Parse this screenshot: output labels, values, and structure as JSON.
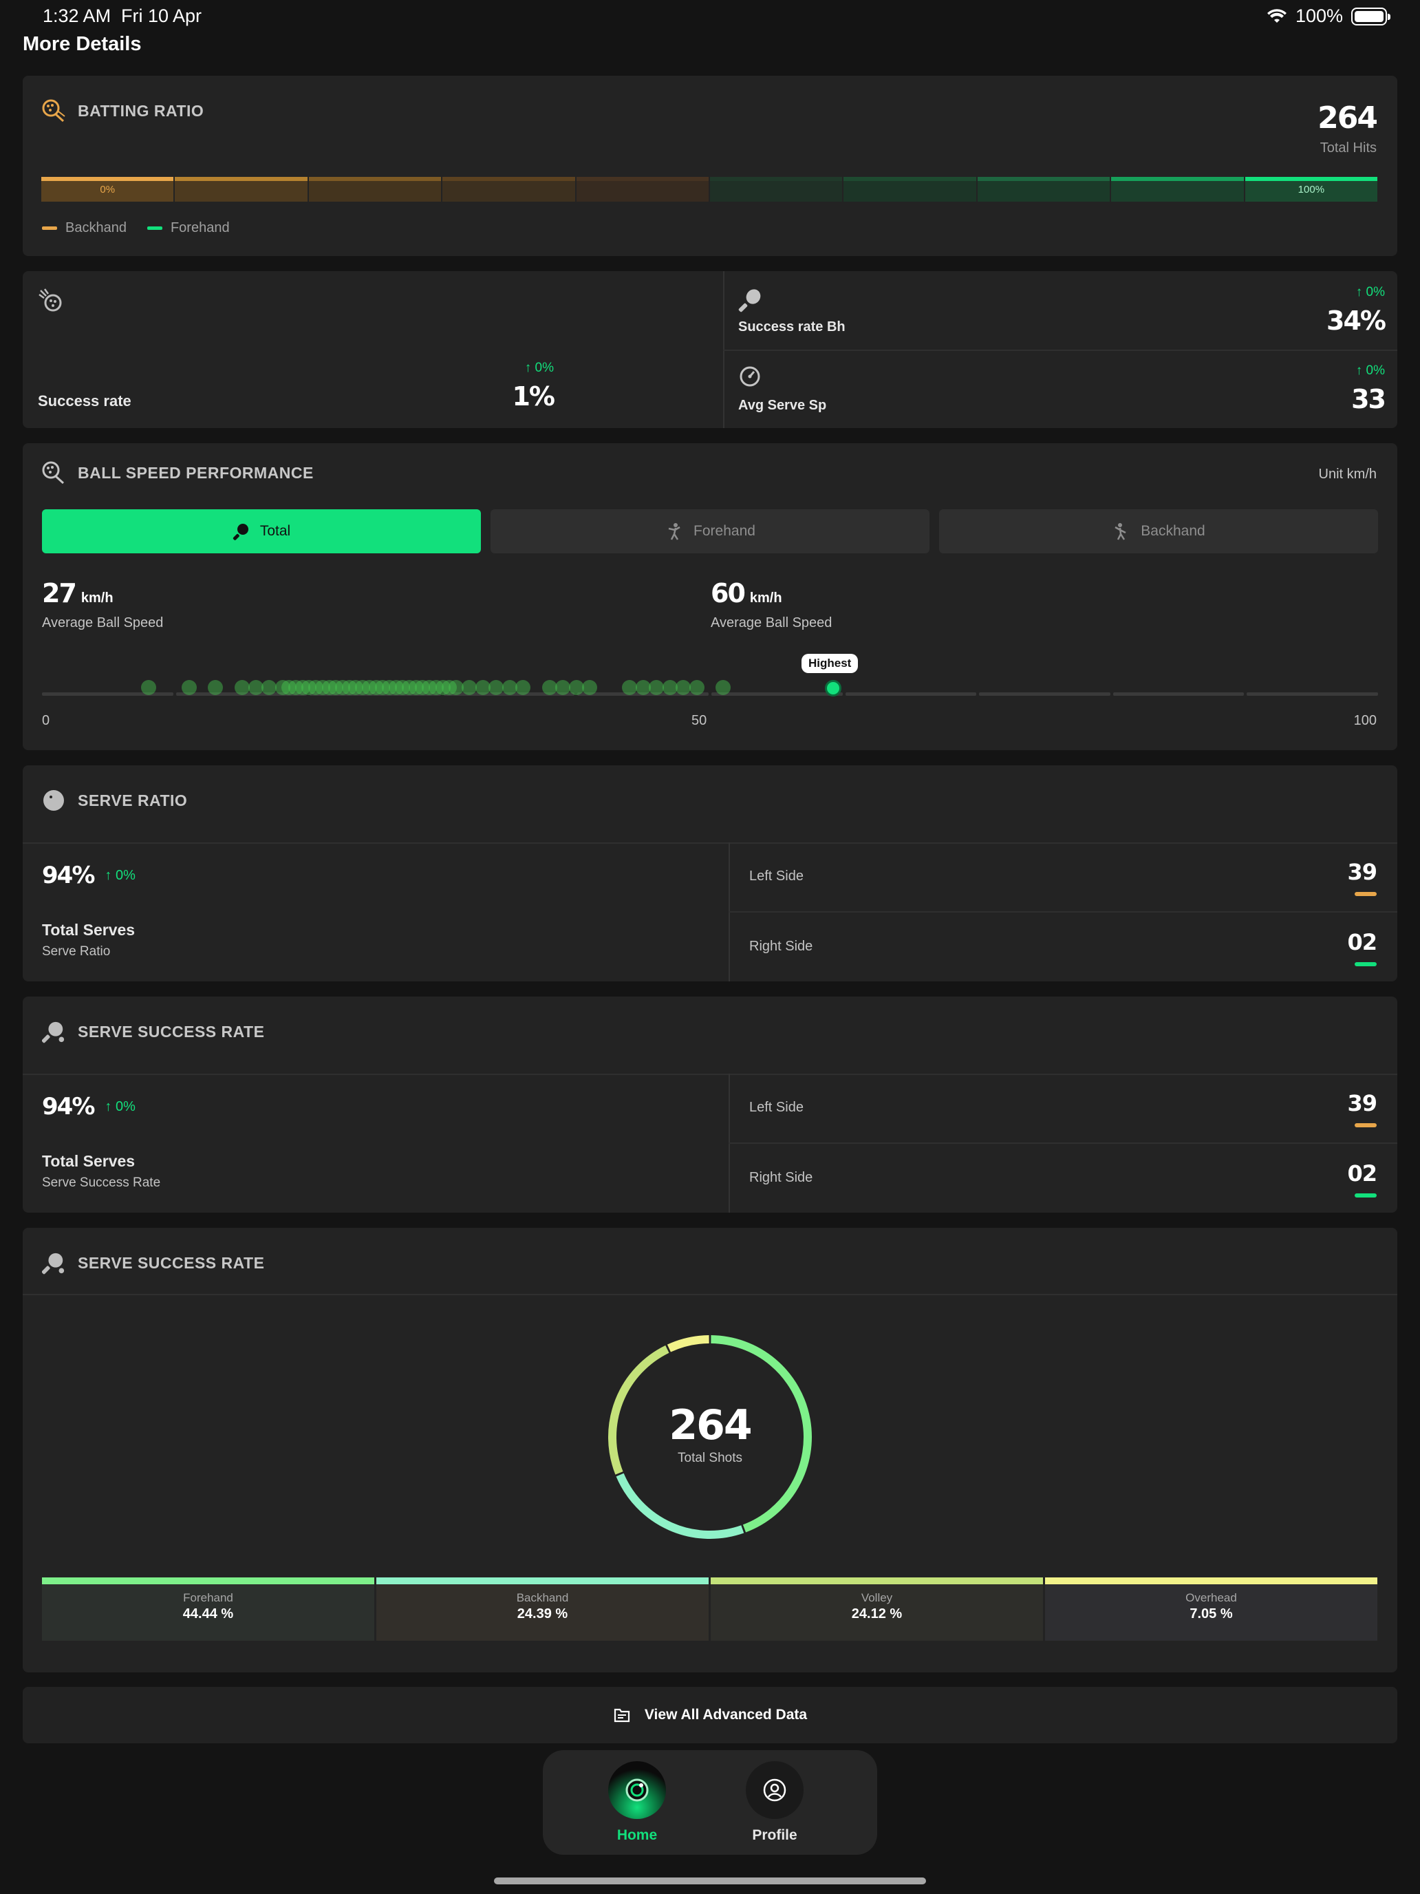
{
  "status": {
    "time": "1:32 AM",
    "date": "Fri 10 Apr",
    "battery": "100%"
  },
  "page_title": "More Details",
  "batting": {
    "title": "BATTING RATIO",
    "total": "264",
    "total_label": "Total Hits",
    "left_label": "0%",
    "right_label": "100%",
    "legend_backhand": "Backhand",
    "legend_forehand": "Forehand",
    "colors": {
      "backhand": "#e8a64a",
      "forehand": "#12e07c"
    }
  },
  "stats": {
    "success_rate_label": "Success rate",
    "success_rate_delta": "↑ 0%",
    "success_rate_value": "1%",
    "bh_label": "Success rate Bh",
    "bh_delta": "↑ 0%",
    "bh_value": "34%",
    "serve_sp_label": "Avg Serve Sp",
    "serve_sp_delta": "↑ 0%",
    "serve_sp_value": "33"
  },
  "speed": {
    "title": "BALL SPEED PERFORMANCE",
    "unit": "Unit km/h",
    "tabs": [
      "Total",
      "Forehand",
      "Backhand"
    ],
    "avg_value": "27",
    "avg_unit": "km/h",
    "avg_label": "Average Ball Speed",
    "max_value": "60",
    "max_unit": "km/h",
    "max_label": "Average Ball Speed",
    "highest_label": "Highest",
    "axis": [
      "0",
      "50",
      "100"
    ],
    "highest_speed": 60
  },
  "serve_ratio": {
    "title": "SERVE RATIO",
    "percent": "94%",
    "delta": "↑ 0%",
    "main_label": "Total Serves",
    "sub_label": "Serve Ratio",
    "left_label": "Left Side",
    "left_value": "39",
    "right_label": "Right Side",
    "right_value": "02"
  },
  "serve_success": {
    "title": "SERVE SUCCESS RATE",
    "percent": "94%",
    "delta": "↑ 0%",
    "main_label": "Total Serves",
    "sub_label": "Serve Success Rate",
    "left_label": "Left Side",
    "left_value": "39",
    "right_label": "Right Side",
    "right_value": "02"
  },
  "shots": {
    "title": "SERVE SUCCESS RATE",
    "total": "264",
    "total_label": "Total Shots",
    "items": [
      {
        "name": "Forehand",
        "value": "44.44 %",
        "pct": 44.44,
        "color": "#7ef08a"
      },
      {
        "name": "Backhand",
        "value": "24.39 %",
        "pct": 24.39,
        "color": "#8ff2c8"
      },
      {
        "name": "Volley",
        "value": "24.12 %",
        "pct": 24.12,
        "color": "#c4e27a"
      },
      {
        "name": "Overhead",
        "value": "7.05 %",
        "pct": 7.05,
        "color": "#f2f28a"
      }
    ]
  },
  "view_all": "View All Advanced Data",
  "nav": {
    "home": "Home",
    "profile": "Profile"
  }
}
